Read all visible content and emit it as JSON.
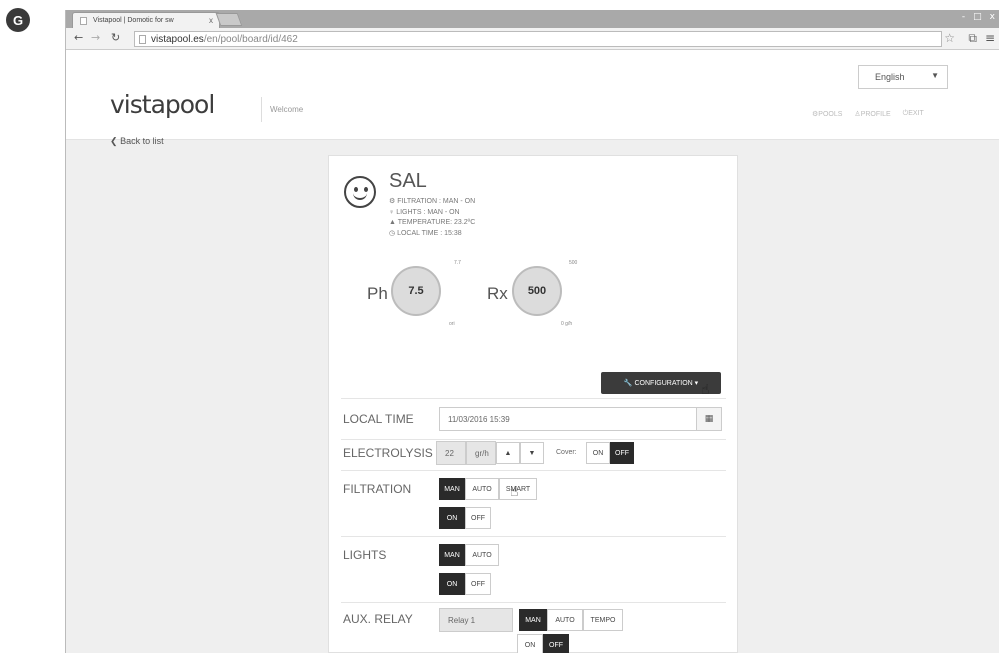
{
  "badge": "G",
  "browser": {
    "tab_title": "Vistapool | Domotic for sw",
    "tab_close": "x",
    "win_controls": [
      "-",
      "□",
      "x"
    ],
    "url_domain": "vistapool.es",
    "url_path": "/en/pool/board/id/462",
    "icons": [
      "back-arrow-icon",
      "forward-arrow-icon",
      "reload-icon",
      "star-icon",
      "extension-icon",
      "menu-icon"
    ]
  },
  "header": {
    "logo": "vistapool",
    "welcome": "Welcome",
    "language": "English",
    "nav": {
      "pools": "POOLS",
      "profile": "PROFILE",
      "exit": "EXIT"
    }
  },
  "back_link": "Back to list",
  "pool": {
    "name": "SAL",
    "filtration": "FILTRATION : MAN - ON",
    "lights": "LIGHTS : MAN - ON",
    "temperature": "TEMPERATURE: 23.2ºC",
    "local_time": "LOCAL TIME : 15:38"
  },
  "gauges": {
    "ph": {
      "label": "Ph",
      "value": "7.5",
      "setpoint": "7.7",
      "unit": "ori"
    },
    "rx": {
      "label": "Rx",
      "value": "500",
      "setpoint": "500",
      "unit": "0 g/h"
    }
  },
  "config_button": "CONFIGURATION ▾",
  "rows": {
    "local_time": {
      "label": "LOCAL TIME",
      "value": "11/03/2016 15:39"
    },
    "electrolysis": {
      "label": "ELECTROLYSIS",
      "value": "22",
      "unit": "gr/h",
      "cover_label": "Cover:",
      "on": "ON",
      "off": "OFF"
    },
    "filtration": {
      "label": "FILTRATION",
      "man": "MAN",
      "auto": "AUTO",
      "smart": "SMART",
      "on": "ON",
      "off": "OFF"
    },
    "lights": {
      "label": "LIGHTS",
      "man": "MAN",
      "auto": "AUTO",
      "on": "ON",
      "off": "OFF"
    },
    "aux_relay": {
      "label": "AUX. RELAY",
      "relay": "Relay 1",
      "man": "MAN",
      "auto": "AUTO",
      "tempo": "TEMPO",
      "on": "ON",
      "off": "OFF"
    }
  }
}
